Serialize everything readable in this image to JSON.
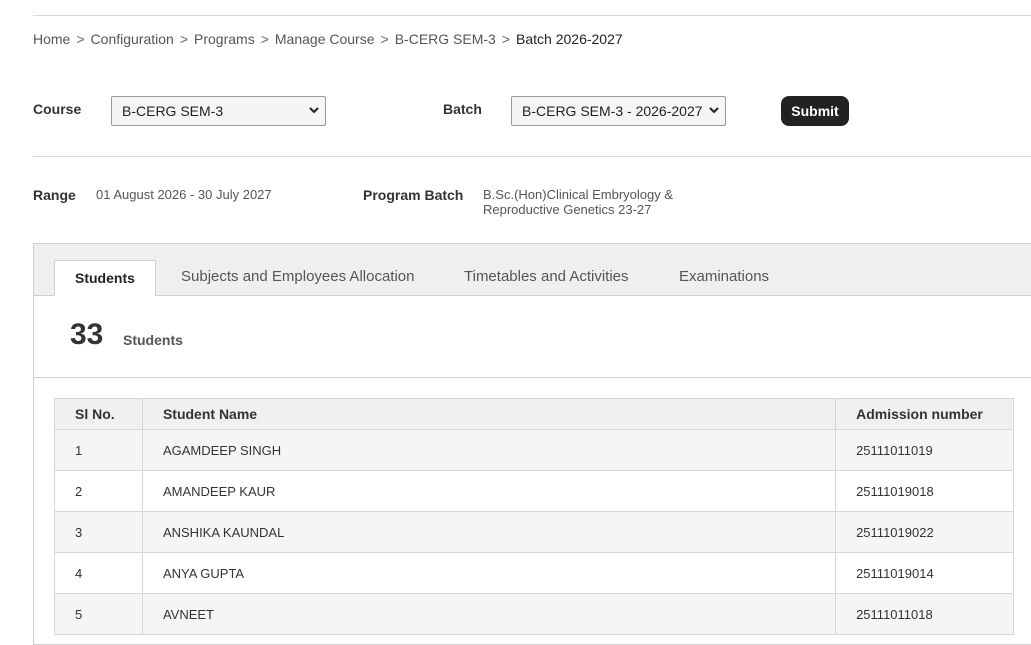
{
  "breadcrumb": {
    "items": [
      "Home",
      "Configuration",
      "Programs",
      "Manage Course",
      "B-CERG SEM-3"
    ],
    "current": "Batch 2026-2027",
    "separator": ">"
  },
  "filters": {
    "course_label": "Course",
    "course_value": "B-CERG SEM-3",
    "batch_label": "Batch",
    "batch_value": "B-CERG SEM-3 - 2026-2027",
    "submit_label": "Submit"
  },
  "info": {
    "range_label": "Range",
    "range_value": "01 August 2026 - 30 July 2027",
    "program_batch_label": "Program Batch",
    "program_batch_line1": "B.Sc.(Hon)Clinical Embryology &",
    "program_batch_line2": "Reproductive Genetics 23-27"
  },
  "tabs": [
    {
      "label": "Students",
      "active": true
    },
    {
      "label": "Subjects and Employees Allocation",
      "active": false
    },
    {
      "label": "Timetables and Activities",
      "active": false
    },
    {
      "label": "Examinations",
      "active": false
    }
  ],
  "students_count": {
    "number": "33",
    "label": "Students"
  },
  "table": {
    "headers": [
      "Sl No.",
      "Student Name",
      "Admission number"
    ],
    "rows": [
      {
        "sl": "1",
        "name": "AGAMDEEP SINGH",
        "admission": "25111011019"
      },
      {
        "sl": "2",
        "name": "AMANDEEP KAUR",
        "admission": "25111019018"
      },
      {
        "sl": "3",
        "name": "ANSHIKA KAUNDAL",
        "admission": "25111019022"
      },
      {
        "sl": "4",
        "name": "ANYA GUPTA",
        "admission": "25111019014"
      },
      {
        "sl": "5",
        "name": "AVNEET",
        "admission": "25111011018"
      }
    ]
  },
  "icons": {
    "dropdown": "chevron-down-icon"
  }
}
